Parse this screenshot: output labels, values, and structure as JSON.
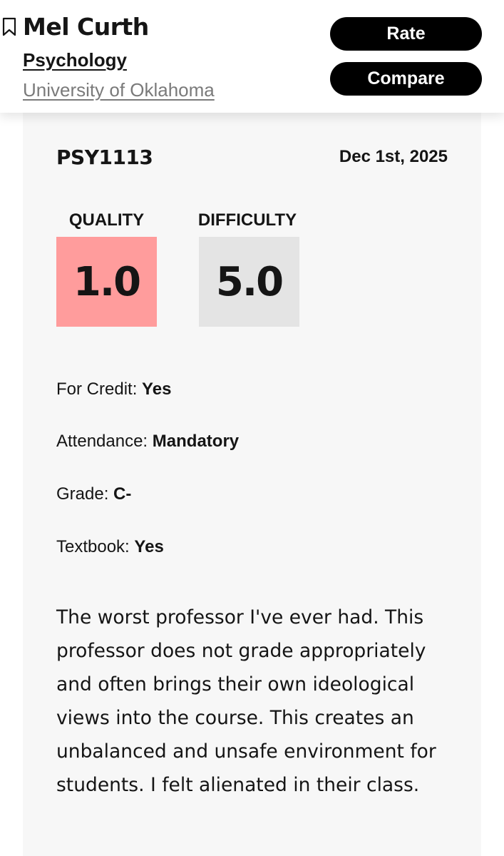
{
  "header": {
    "professor_name": "Mel Curth",
    "department": "Psychology",
    "school": "University of Oklahoma",
    "rate_label": "Rate",
    "compare_label": "Compare"
  },
  "rating": {
    "course": "PSY1113",
    "date": "Dec 1st, 2025",
    "quality_label": "QUALITY",
    "quality_value": "1.0",
    "difficulty_label": "DIFFICULTY",
    "difficulty_value": "5.0",
    "details": [
      {
        "label": "For Credit:",
        "value": "Yes"
      },
      {
        "label": "Attendance:",
        "value": "Mandatory"
      },
      {
        "label": "Grade:",
        "value": "C-"
      },
      {
        "label": "Textbook:",
        "value": "Yes"
      }
    ],
    "comment": "The worst professor I've ever had. This professor does not grade appropriately and often brings their own ideological views into the course. This creates an unbalanced and unsafe environment for students. I felt alienated in their class."
  },
  "colors": {
    "quality_box": "#ff9c9c",
    "difficulty_box": "#e4e4e4",
    "button_bg": "#000000",
    "card_bg": "#f7f7f7"
  },
  "icons": {
    "bookmark": "bookmark-icon"
  }
}
